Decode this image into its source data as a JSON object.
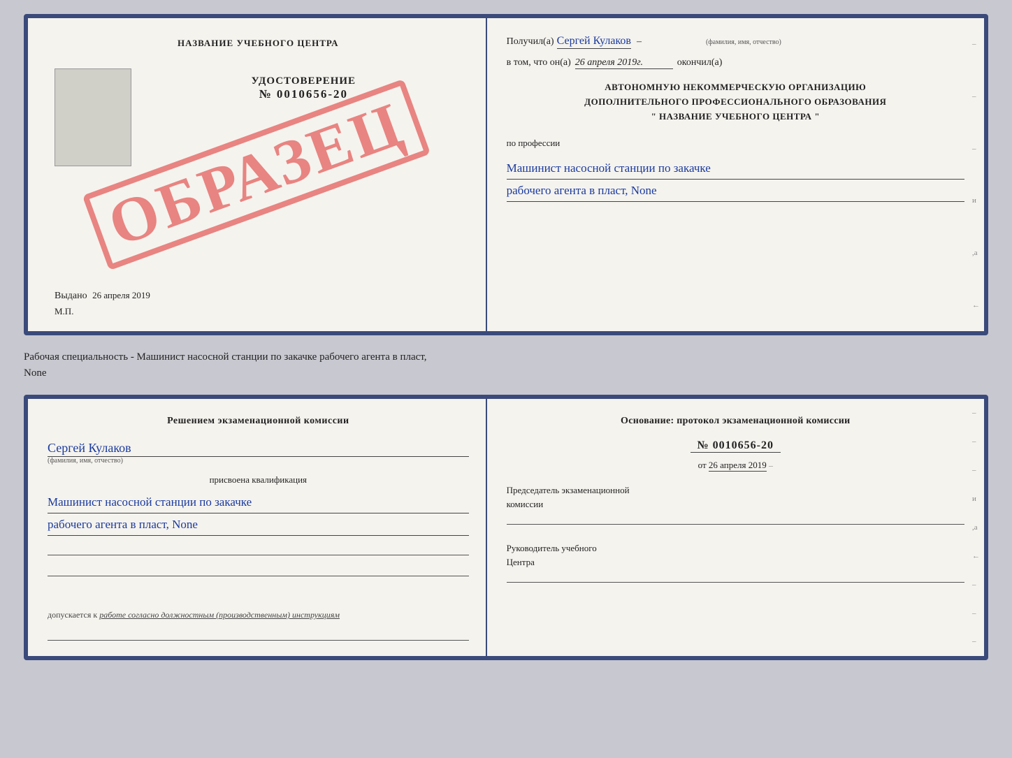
{
  "top_doc": {
    "left": {
      "title": "НАЗВАНИЕ УЧЕБНОГО ЦЕНТРА",
      "udostoverenie_label": "УДОСТОВЕРЕНИЕ",
      "number": "№ 0010656-20",
      "stamp": "ОБРАЗЕЦ",
      "vydano": "Выдано",
      "vydano_date": "26 апреля 2019",
      "mp": "М.П."
    },
    "right": {
      "poluchil_label": "Получил(а)",
      "poluchil_name": "Сергей Кулаков",
      "familiya_hint": "(фамилия, имя, отчество)",
      "vtom_label": "в том, что он(а)",
      "vtom_date": "26 апреля 2019г.",
      "okonchil_label": "окончил(а)",
      "center_line1": "АВТОНОМНУЮ НЕКОММЕРЧЕСКУЮ ОРГАНИЗАЦИЮ",
      "center_line2": "ДОПОЛНИТЕЛЬНОГО ПРОФЕССИОНАЛЬНОГО ОБРАЗОВАНИЯ",
      "center_line3": "\"    НАЗВАНИЕ УЧЕБНОГО ЦЕНТРА    \"",
      "po_professii": "по профессии",
      "profession_line1": "Машинист насосной станции по закачке",
      "profession_line2": "рабочего агента в пласт, None",
      "side_marks": [
        "-",
        "-",
        "-",
        "и",
        ",а",
        "←"
      ]
    }
  },
  "separator": {
    "text": "Рабочая специальность - Машинист насосной станции по закачке рабочего агента в пласт,",
    "text2": "None"
  },
  "bottom_doc": {
    "left": {
      "resheniem_title": "Решением  экзаменационной  комиссии",
      "person_name": "Сергей Кулаков",
      "familiya_hint": "(фамилия, имя, отчество)",
      "prisvoena_label": "присвоена квалификация",
      "profession_line1": "Машинист насосной станции по закачке",
      "profession_line2": "рабочего агента в пласт, None",
      "dopuskaetsya_label": "допускается к",
      "dopuskaetsya_text": "работе согласно должностным (производственным) инструкциям"
    },
    "right": {
      "osnovanie_label": "Основание: протокол экзаменационной комиссии",
      "protocol_number": "№  0010656-20",
      "ot_label": "от",
      "ot_date": "26 апреля 2019",
      "predsedatel_line1": "Председатель экзаменационной",
      "predsedatel_line2": "комиссии",
      "rukovoditel_line1": "Руководитель учебного",
      "rukovoditel_line2": "Центра",
      "side_marks": [
        "-",
        "-",
        "-",
        "и",
        ",а",
        "←",
        "-",
        "-",
        "-"
      ]
    }
  }
}
